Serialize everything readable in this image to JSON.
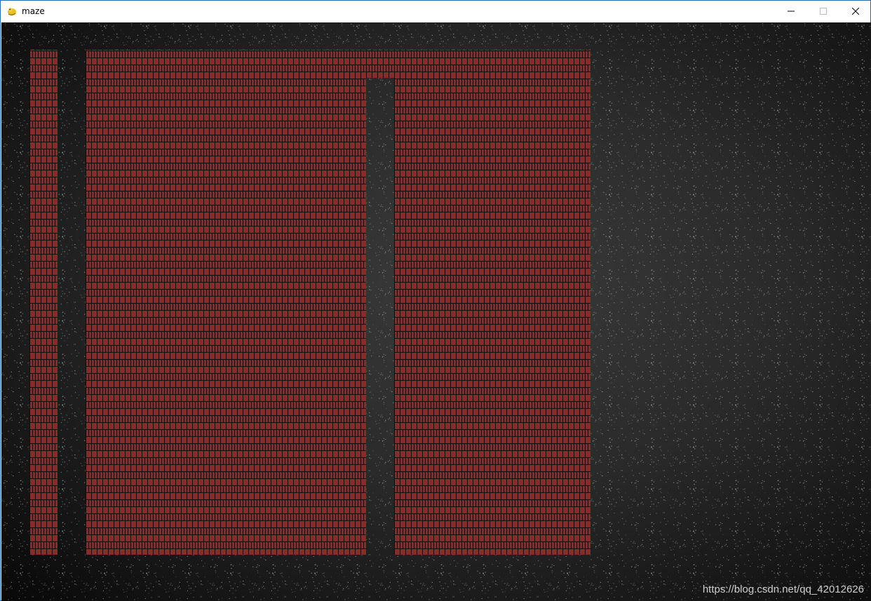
{
  "window": {
    "title": "maze",
    "app_icon": "pygame-snake-icon",
    "controls": [
      "minimize-icon",
      "maximize-icon",
      "close-icon"
    ]
  },
  "colors": {
    "wall": "#8a2b2b",
    "wall_mortar": "#1a0606",
    "floor": "#3a3a3a",
    "background": "#1c1c1c"
  },
  "maze": {
    "rows": [
      "#.##################",
      "#.##########.#######",
      "#.##########.#######",
      "#.##########.#######",
      "#.##########.#######",
      "#.##########.#######",
      "#.##########.#######",
      "#.##########.#######",
      "#.##########.#######",
      "#.##########.#######",
      "#.##########.#######",
      "#.##########.#######",
      "#.##########.#######",
      "#.##########.#######",
      "#.##########.#######",
      "#.##########.#######",
      "#.##########.#######",
      "#.##########.#######"
    ]
  },
  "watermark": "https://blog.csdn.net/qq_42012626"
}
